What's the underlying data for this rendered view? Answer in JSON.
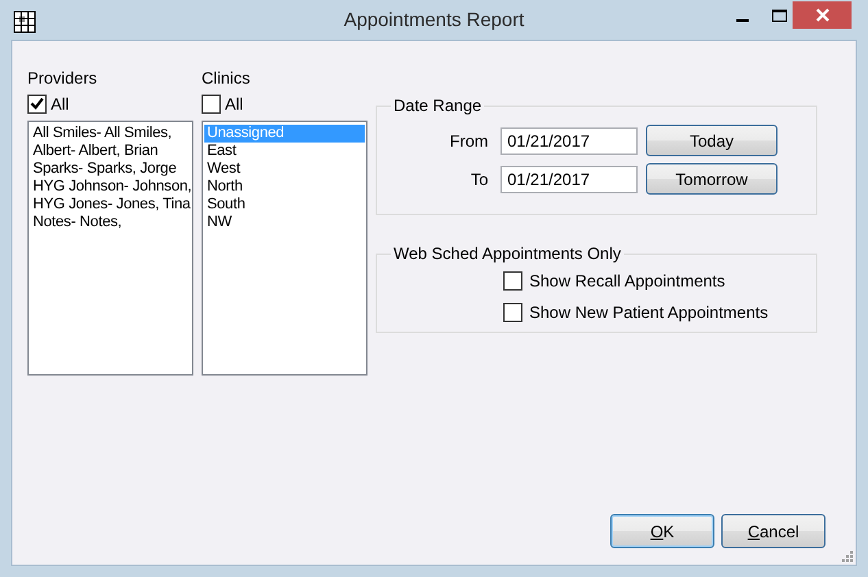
{
  "window": {
    "title": "Appointments Report"
  },
  "providers": {
    "label": "Providers",
    "all": {
      "label": "All",
      "checked": true
    },
    "items": [
      {
        "text": "All Smiles- All Smiles,",
        "selected": false
      },
      {
        "text": "Albert- Albert, Brian",
        "selected": false
      },
      {
        "text": "Sparks- Sparks, Jorge",
        "selected": false
      },
      {
        "text": "HYG Johnson- Johnson,",
        "selected": false
      },
      {
        "text": "HYG Jones- Jones, Tina",
        "selected": false
      },
      {
        "text": "Notes- Notes,",
        "selected": false
      }
    ]
  },
  "clinics": {
    "label": "Clinics",
    "all": {
      "label": "All",
      "checked": false
    },
    "items": [
      {
        "text": "Unassigned",
        "selected": true
      },
      {
        "text": "East",
        "selected": false
      },
      {
        "text": "West",
        "selected": false
      },
      {
        "text": "North",
        "selected": false
      },
      {
        "text": "South",
        "selected": false
      },
      {
        "text": "NW",
        "selected": false
      }
    ]
  },
  "date_range": {
    "title": "Date Range",
    "rows": [
      {
        "label": "From",
        "value": "01/21/2017",
        "button": "Today"
      },
      {
        "label": "To",
        "value": "01/21/2017",
        "button": "Tomorrow"
      }
    ]
  },
  "web_sched": {
    "title": "Web Sched Appointments Only",
    "options": [
      {
        "label": "Show Recall Appointments",
        "checked": false
      },
      {
        "label": "Show New Patient Appointments",
        "checked": false
      }
    ]
  },
  "buttons": [
    {
      "mnemonic": "O",
      "text": "K",
      "default": true
    },
    {
      "mnemonic": "C",
      "text": "ancel",
      "default": false
    }
  ]
}
